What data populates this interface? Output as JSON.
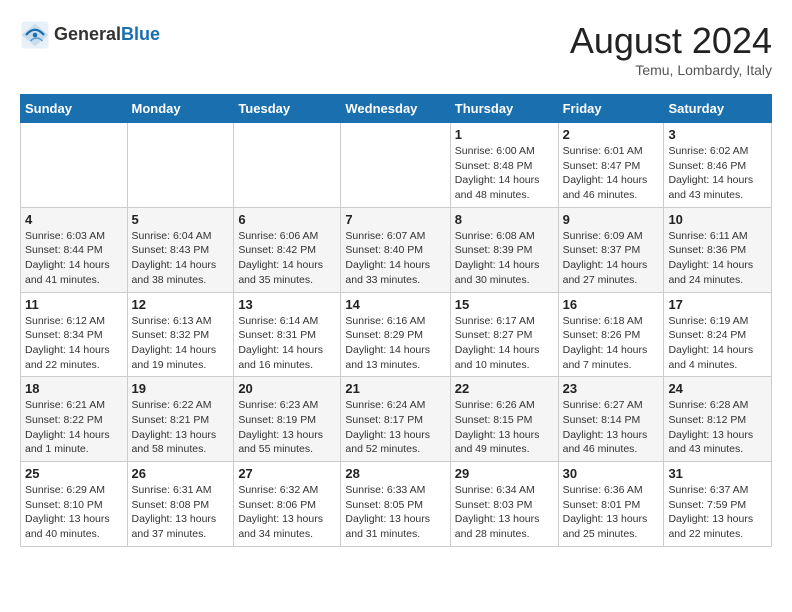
{
  "header": {
    "logo_general": "General",
    "logo_blue": "Blue",
    "month_year": "August 2024",
    "location": "Temu, Lombardy, Italy"
  },
  "weekdays": [
    "Sunday",
    "Monday",
    "Tuesday",
    "Wednesday",
    "Thursday",
    "Friday",
    "Saturday"
  ],
  "weeks": [
    [
      {
        "day": "",
        "info": ""
      },
      {
        "day": "",
        "info": ""
      },
      {
        "day": "",
        "info": ""
      },
      {
        "day": "",
        "info": ""
      },
      {
        "day": "1",
        "info": "Sunrise: 6:00 AM\nSunset: 8:48 PM\nDaylight: 14 hours\nand 48 minutes."
      },
      {
        "day": "2",
        "info": "Sunrise: 6:01 AM\nSunset: 8:47 PM\nDaylight: 14 hours\nand 46 minutes."
      },
      {
        "day": "3",
        "info": "Sunrise: 6:02 AM\nSunset: 8:46 PM\nDaylight: 14 hours\nand 43 minutes."
      }
    ],
    [
      {
        "day": "4",
        "info": "Sunrise: 6:03 AM\nSunset: 8:44 PM\nDaylight: 14 hours\nand 41 minutes."
      },
      {
        "day": "5",
        "info": "Sunrise: 6:04 AM\nSunset: 8:43 PM\nDaylight: 14 hours\nand 38 minutes."
      },
      {
        "day": "6",
        "info": "Sunrise: 6:06 AM\nSunset: 8:42 PM\nDaylight: 14 hours\nand 35 minutes."
      },
      {
        "day": "7",
        "info": "Sunrise: 6:07 AM\nSunset: 8:40 PM\nDaylight: 14 hours\nand 33 minutes."
      },
      {
        "day": "8",
        "info": "Sunrise: 6:08 AM\nSunset: 8:39 PM\nDaylight: 14 hours\nand 30 minutes."
      },
      {
        "day": "9",
        "info": "Sunrise: 6:09 AM\nSunset: 8:37 PM\nDaylight: 14 hours\nand 27 minutes."
      },
      {
        "day": "10",
        "info": "Sunrise: 6:11 AM\nSunset: 8:36 PM\nDaylight: 14 hours\nand 24 minutes."
      }
    ],
    [
      {
        "day": "11",
        "info": "Sunrise: 6:12 AM\nSunset: 8:34 PM\nDaylight: 14 hours\nand 22 minutes."
      },
      {
        "day": "12",
        "info": "Sunrise: 6:13 AM\nSunset: 8:32 PM\nDaylight: 14 hours\nand 19 minutes."
      },
      {
        "day": "13",
        "info": "Sunrise: 6:14 AM\nSunset: 8:31 PM\nDaylight: 14 hours\nand 16 minutes."
      },
      {
        "day": "14",
        "info": "Sunrise: 6:16 AM\nSunset: 8:29 PM\nDaylight: 14 hours\nand 13 minutes."
      },
      {
        "day": "15",
        "info": "Sunrise: 6:17 AM\nSunset: 8:27 PM\nDaylight: 14 hours\nand 10 minutes."
      },
      {
        "day": "16",
        "info": "Sunrise: 6:18 AM\nSunset: 8:26 PM\nDaylight: 14 hours\nand 7 minutes."
      },
      {
        "day": "17",
        "info": "Sunrise: 6:19 AM\nSunset: 8:24 PM\nDaylight: 14 hours\nand 4 minutes."
      }
    ],
    [
      {
        "day": "18",
        "info": "Sunrise: 6:21 AM\nSunset: 8:22 PM\nDaylight: 14 hours\nand 1 minute."
      },
      {
        "day": "19",
        "info": "Sunrise: 6:22 AM\nSunset: 8:21 PM\nDaylight: 13 hours\nand 58 minutes."
      },
      {
        "day": "20",
        "info": "Sunrise: 6:23 AM\nSunset: 8:19 PM\nDaylight: 13 hours\nand 55 minutes."
      },
      {
        "day": "21",
        "info": "Sunrise: 6:24 AM\nSunset: 8:17 PM\nDaylight: 13 hours\nand 52 minutes."
      },
      {
        "day": "22",
        "info": "Sunrise: 6:26 AM\nSunset: 8:15 PM\nDaylight: 13 hours\nand 49 minutes."
      },
      {
        "day": "23",
        "info": "Sunrise: 6:27 AM\nSunset: 8:14 PM\nDaylight: 13 hours\nand 46 minutes."
      },
      {
        "day": "24",
        "info": "Sunrise: 6:28 AM\nSunset: 8:12 PM\nDaylight: 13 hours\nand 43 minutes."
      }
    ],
    [
      {
        "day": "25",
        "info": "Sunrise: 6:29 AM\nSunset: 8:10 PM\nDaylight: 13 hours\nand 40 minutes."
      },
      {
        "day": "26",
        "info": "Sunrise: 6:31 AM\nSunset: 8:08 PM\nDaylight: 13 hours\nand 37 minutes."
      },
      {
        "day": "27",
        "info": "Sunrise: 6:32 AM\nSunset: 8:06 PM\nDaylight: 13 hours\nand 34 minutes."
      },
      {
        "day": "28",
        "info": "Sunrise: 6:33 AM\nSunset: 8:05 PM\nDaylight: 13 hours\nand 31 minutes."
      },
      {
        "day": "29",
        "info": "Sunrise: 6:34 AM\nSunset: 8:03 PM\nDaylight: 13 hours\nand 28 minutes."
      },
      {
        "day": "30",
        "info": "Sunrise: 6:36 AM\nSunset: 8:01 PM\nDaylight: 13 hours\nand 25 minutes."
      },
      {
        "day": "31",
        "info": "Sunrise: 6:37 AM\nSunset: 7:59 PM\nDaylight: 13 hours\nand 22 minutes."
      }
    ]
  ]
}
